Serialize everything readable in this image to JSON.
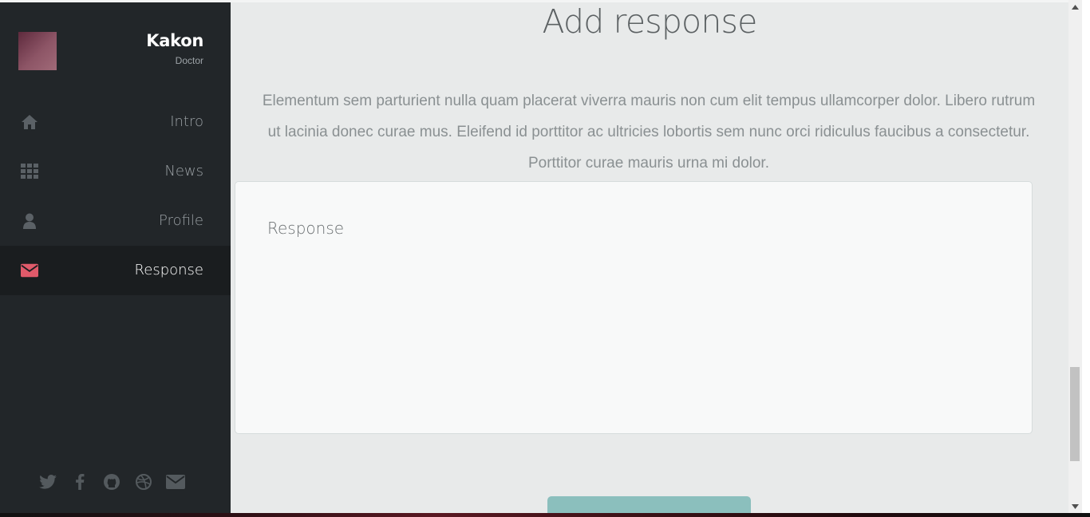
{
  "profile": {
    "name": "Kakon",
    "role": "Doctor"
  },
  "nav": {
    "items": [
      {
        "label": "Intro",
        "icon": "home-icon"
      },
      {
        "label": "News",
        "icon": "grid-icon"
      },
      {
        "label": "Profile",
        "icon": "user-icon"
      },
      {
        "label": "Response",
        "icon": "envelope-icon",
        "active": true
      }
    ]
  },
  "socials": [
    "twitter-icon",
    "facebook-icon",
    "github-icon",
    "dribbble-icon",
    "envelope-icon"
  ],
  "main": {
    "heading": "Add response",
    "paragraph": "Elementum sem parturient nulla quam placerat viverra mauris non cum elit tempus ullamcorper dolor. Libero rutrum ut lacinia donec curae mus. Eleifend id porttitor ac ultricies lobortis sem nunc orci ridiculus faucibus a consectetur. Porttitor curae mauris urna mi dolor.",
    "response_placeholder": "Response"
  },
  "colors": {
    "sidebar_bg": "#222629",
    "active_icon": "#e05a6a",
    "accent_button": "#8bbfbd",
    "main_bg": "#e8eaea"
  }
}
